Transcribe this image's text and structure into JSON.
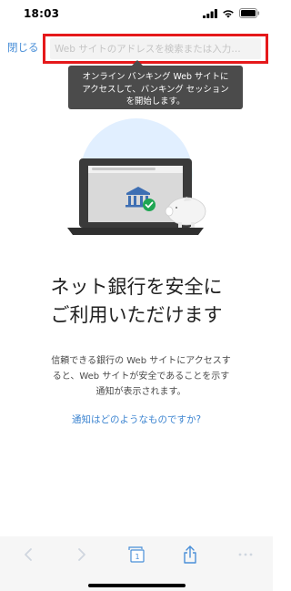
{
  "status_bar": {
    "time": "18:03"
  },
  "nav": {
    "close_label": "閉じる",
    "url_placeholder": "Web サイトのアドレスを検索または入力…"
  },
  "tooltip": {
    "line1": "オンライン バンキング Web サイトに",
    "line2": "アクセスして、バンキング セッション",
    "line3": "を開始します。"
  },
  "main": {
    "headline_line1": "ネット銀行を安全に",
    "headline_line2": "ご利用いただけます",
    "body_line1": "信頼できる銀行の Web サイトにアクセスす",
    "body_line2": "ると、Web サイトが安全であることを示す",
    "body_line3": "通知が表示されます。",
    "help_link": "通知はどのようなものですか?"
  },
  "toolbar": {
    "tab_count": "1"
  },
  "colors": {
    "highlight": "#e5191b",
    "link": "#3f86d1",
    "tooltip_bg": "#4b4b4b",
    "toolbar_bg": "#f6f6f6",
    "check_green": "#1fa653"
  }
}
